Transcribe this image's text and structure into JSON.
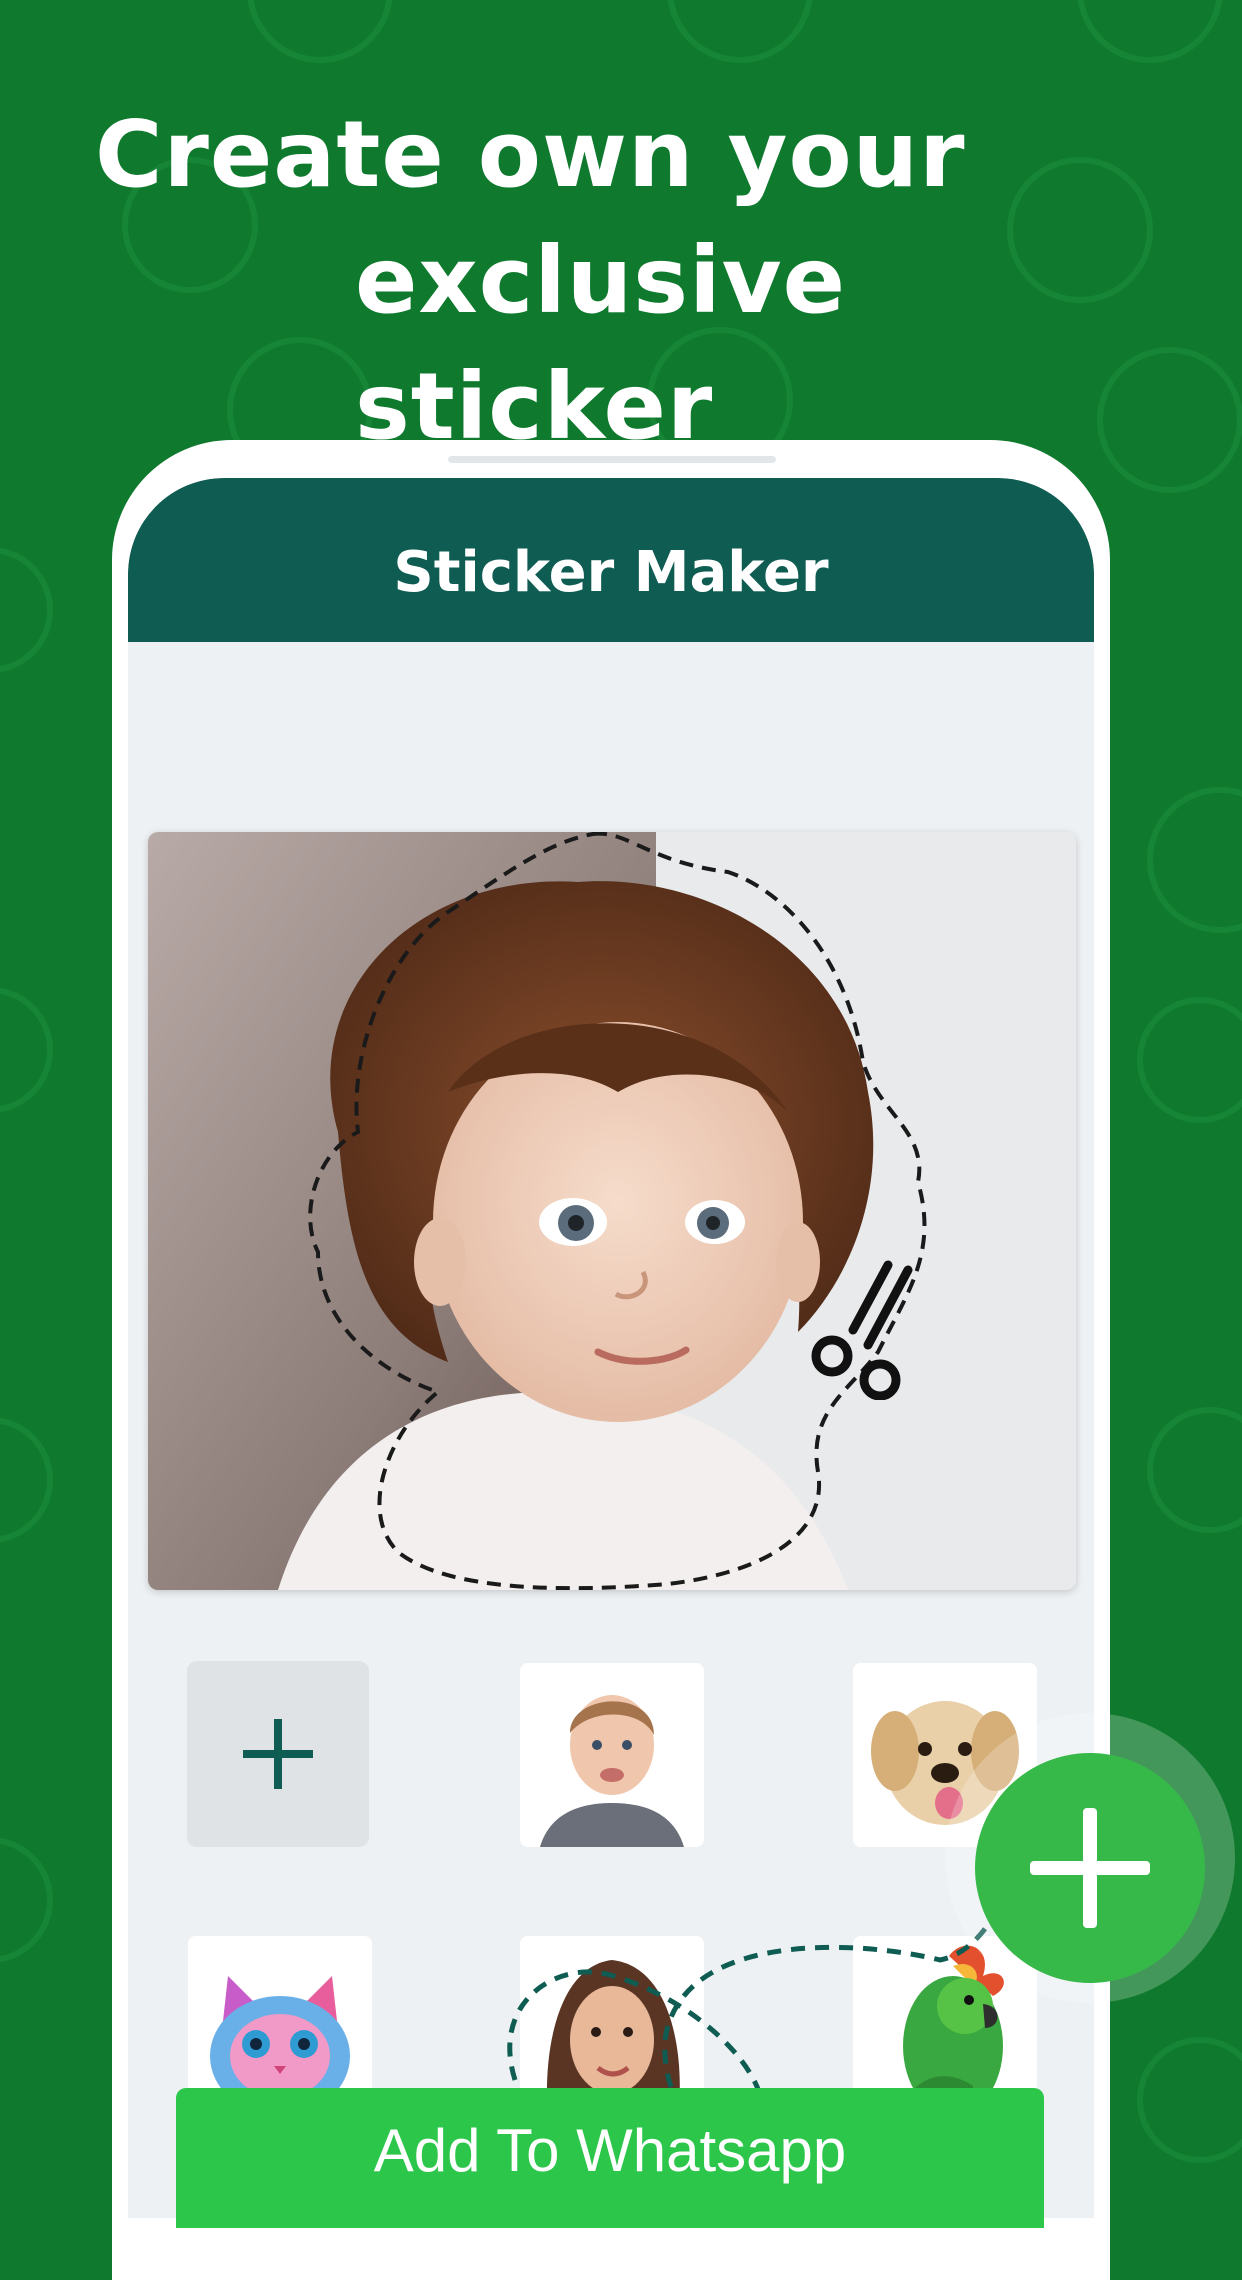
{
  "headline": {
    "line1": "Create own your",
    "line2": "exclusive sticker"
  },
  "app": {
    "title": "Sticker Maker"
  },
  "preview": {
    "subject": "baby-photo",
    "cut_icon": "scissors-icon"
  },
  "stickers": [
    {
      "kind": "add",
      "icon": "plus-icon"
    },
    {
      "kind": "image",
      "subject": "boy"
    },
    {
      "kind": "image",
      "subject": "puppy"
    },
    {
      "kind": "image",
      "subject": "cat"
    },
    {
      "kind": "image",
      "subject": "woman"
    },
    {
      "kind": "image",
      "subject": "parrot"
    }
  ],
  "fab": {
    "icon": "plus-icon"
  },
  "cta": {
    "label": "Add To Whatsapp"
  },
  "colors": {
    "background": "#0f7a2e",
    "header": "#0f5c53",
    "button": "#2bc64a",
    "fab": "#37b94a",
    "screen": "#eef1f4"
  }
}
